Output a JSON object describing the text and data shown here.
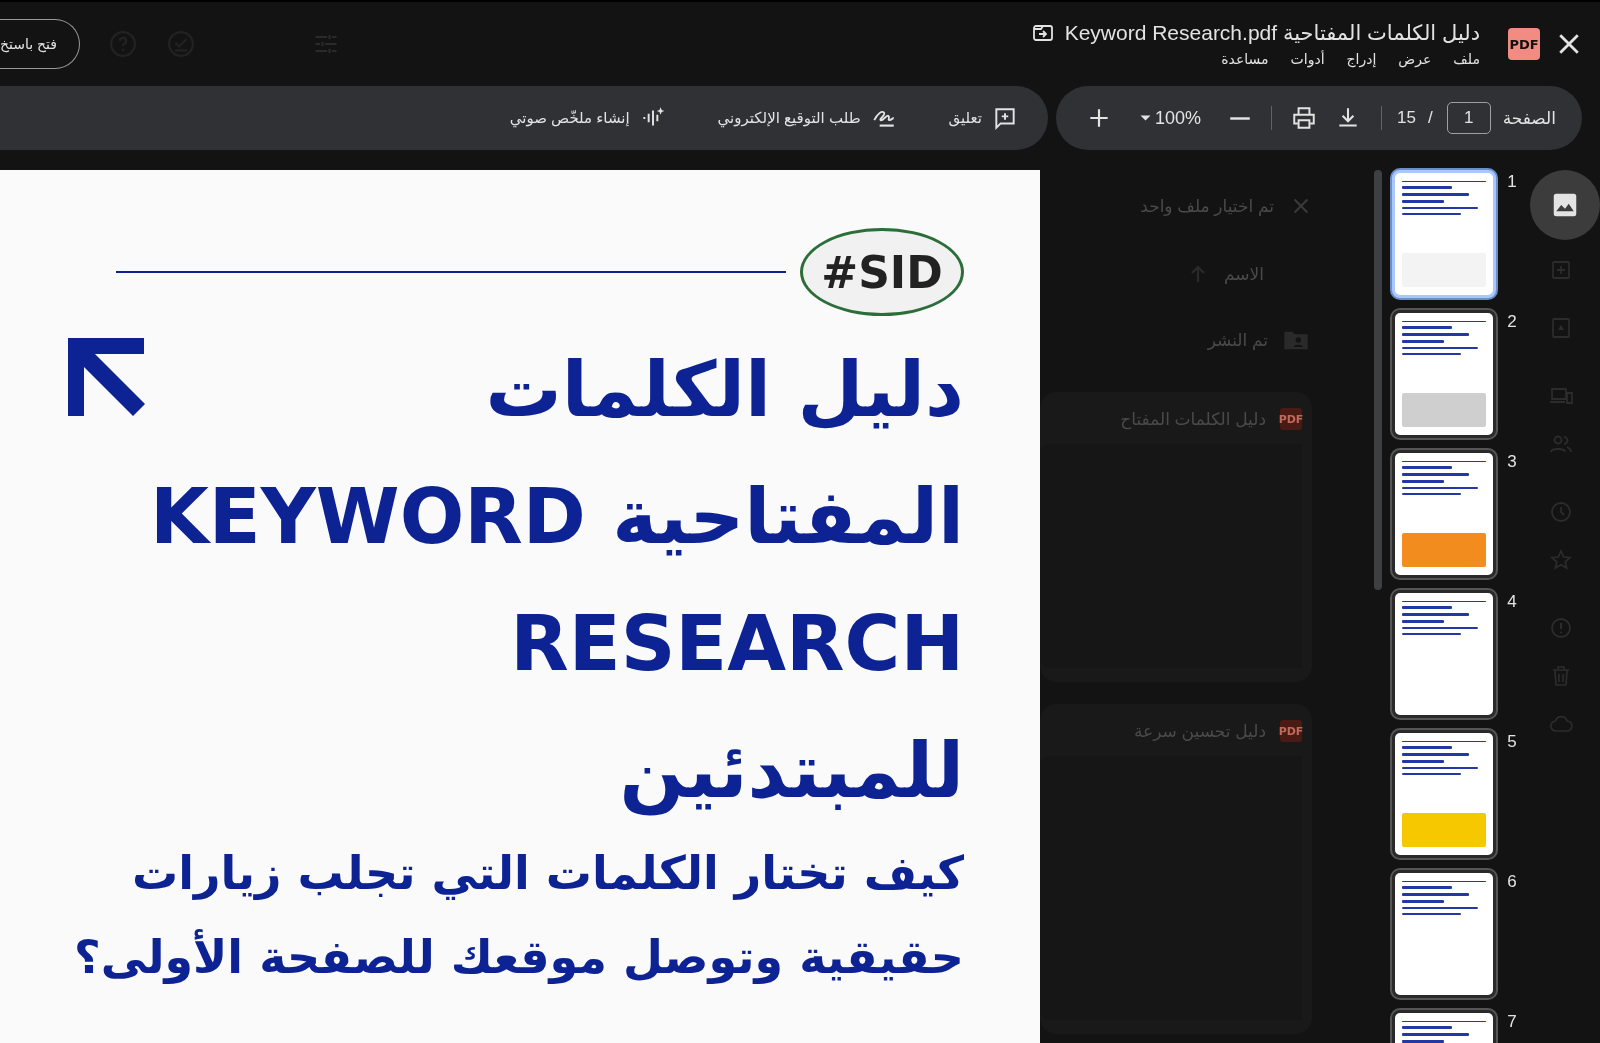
{
  "header": {
    "open_with_button": "فتح باستخ",
    "title": "دليل الكلمات المفتاحية Keyword Research.pdf",
    "file_badge": "PDF",
    "menu": [
      "ملف",
      "عرض",
      "إدراج",
      "أدوات",
      "مساعدة"
    ]
  },
  "toolbar": {
    "actions": [
      {
        "kind": "comment",
        "label": "تعليق"
      },
      {
        "kind": "signature",
        "label": "طلب التوقيع الإلكتروني"
      },
      {
        "kind": "audio",
        "label": "إنشاء ملخّص صوتي"
      }
    ],
    "page_label": "الصفحة",
    "page_input": "1",
    "separator": "/",
    "page_total": "15",
    "zoom": "100%"
  },
  "document": {
    "logo": "#SID",
    "title_lines": [
      "دليل الكلمات",
      "المفتاحية KEYWORD",
      "RESEARCH",
      "للمبتدئين"
    ],
    "subtitle_lines": [
      "كيف تختار الكلمات التي تجلب زيارات",
      "حقيقية وتوصل موقعك للصفحة الأولى؟"
    ]
  },
  "background": {
    "selection_text": "تم اختيار ملف واحد",
    "sort_label": "الاسم",
    "folder_label": "تم النشر",
    "files": [
      {
        "badge": "PDF",
        "name": "دليل الكلمات المفتاح"
      },
      {
        "badge": "PDF",
        "name": "دليل تحسين سرعة"
      }
    ]
  },
  "thumbnails": [
    {
      "label": "1",
      "selected": true
    },
    {
      "label": "2",
      "selected": false
    },
    {
      "label": "3",
      "selected": false
    },
    {
      "label": "4",
      "selected": false
    },
    {
      "label": "5",
      "selected": false
    },
    {
      "label": "6",
      "selected": false
    },
    {
      "label": "7",
      "selected": false
    }
  ]
}
